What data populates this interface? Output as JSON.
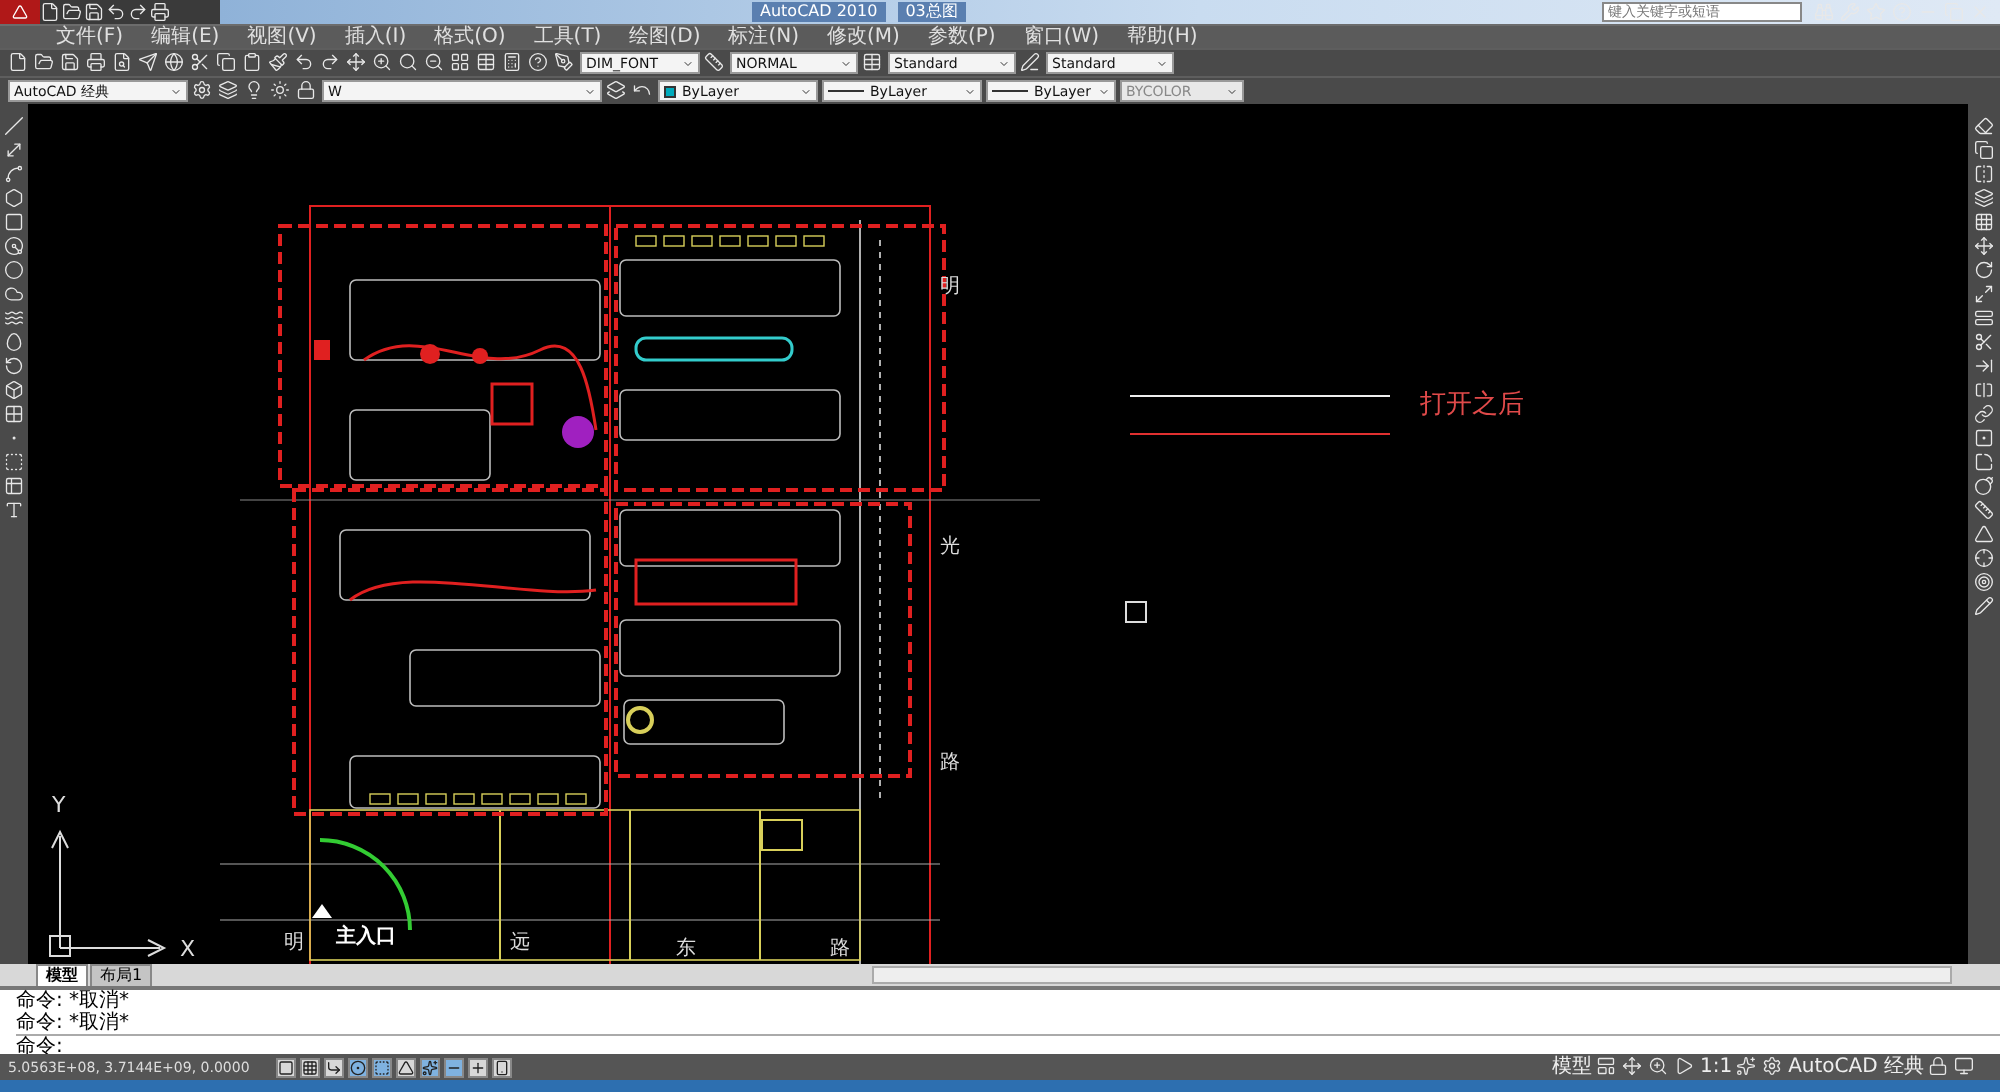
{
  "title_bar": {
    "title": "AutoCAD 2010",
    "document": "03总图",
    "search": {
      "placeholder": "键入关键字或短语"
    }
  },
  "menu_bar": [
    "文件(F)",
    "编辑(E)",
    "视图(V)",
    "插入(I)",
    "格式(O)",
    "工具(T)",
    "绘图(D)",
    "标注(N)",
    "修改(M)",
    "参数(P)",
    "窗口(W)",
    "帮助(H)"
  ],
  "toolbar": {
    "text_style": "DIM_FONT",
    "dim_style": "NORMAL",
    "table_style": "Standard",
    "mleader_style": "Standard"
  },
  "properties_bar": {
    "workspace": "AutoCAD 经典",
    "layer": "W",
    "color_setting": "ByLayer",
    "linetype": "ByLayer",
    "lineweight": "ByLayer",
    "plot_style": "BYCOLOR"
  },
  "drawing": {
    "road_labels": [
      "明",
      "光",
      "路",
      "明",
      "远",
      "东",
      "路"
    ],
    "entrance": "主入口",
    "annotation": "打开之后",
    "ucs": {
      "x": "X",
      "y": "Y"
    }
  },
  "layout_tabs": [
    {
      "label": "模型",
      "selected": true
    },
    {
      "label": "布局1",
      "selected": false
    }
  ],
  "command_history": [
    "命令: *取消*",
    "命令: *取消*"
  ],
  "command_prompt": "命令:",
  "status_bar": {
    "coordinates": "5.0563E+08, 3.7144E+09, 0.0000",
    "toggles": [
      {
        "on": false
      },
      {
        "on": false
      },
      {
        "on": false
      },
      {
        "on": true
      },
      {
        "on": true
      },
      {
        "on": false
      },
      {
        "on": true
      },
      {
        "on": true
      },
      {
        "on": false
      },
      {
        "on": false
      }
    ],
    "space": "模型",
    "annotation_scale": "1:1",
    "workspace": "AutoCAD 经典"
  }
}
